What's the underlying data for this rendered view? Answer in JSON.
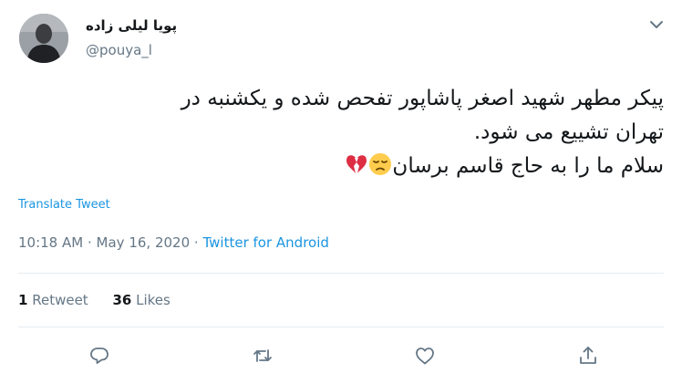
{
  "user": {
    "display_name": "پویا لیلی زاده",
    "handle": "@pouya_l"
  },
  "tweet": {
    "line1": "پیکر مطهر شهید اصغر پاشاپور تفحص شده و یکشنبه در",
    "line2": "تهران تشییع می شود.",
    "line3": "سلام ما را به حاج قاسم برسان"
  },
  "translate_label": "Translate Tweet",
  "meta": {
    "time": "10:18 AM",
    "separator": "·",
    "date": "May 16, 2020",
    "source": "Twitter for Android"
  },
  "stats": {
    "retweets_count": "1",
    "retweets_label": "Retweet",
    "likes_count": "36",
    "likes_label": "Likes"
  },
  "icons": {
    "caret": "chevron-down-icon",
    "reply": "reply-icon",
    "retweet": "retweet-icon",
    "like": "heart-icon",
    "share": "share-icon",
    "emoji1": "pensive-face-emoji",
    "emoji2": "broken-heart-emoji"
  },
  "colors": {
    "accent": "#1b95e0",
    "muted": "#657786",
    "text": "#14171a",
    "divider": "#e6ecf0"
  }
}
